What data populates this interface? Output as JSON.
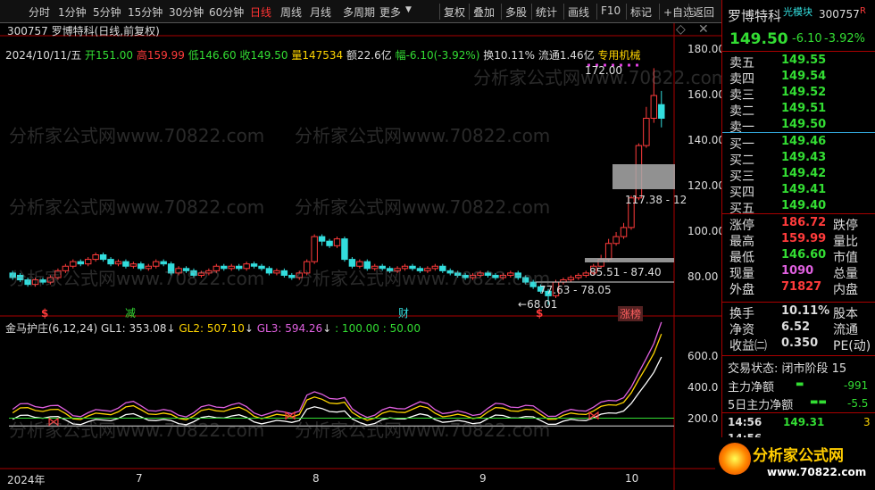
{
  "toolbar": {
    "left": [
      "分时",
      "1分钟",
      "5分钟",
      "15分钟",
      "30分钟",
      "60分钟",
      "日线",
      "周线",
      "月线",
      "多周期",
      "更多"
    ],
    "active": "日线",
    "right": [
      "复权",
      "叠加",
      "多股",
      "统计",
      "画线",
      "F10",
      "标记",
      "+自选",
      "返回"
    ]
  },
  "chart": {
    "title": "300757 罗博特科(日线,前复权)",
    "info_date": "2024/10/11/五",
    "info_open": "开151.00",
    "info_high": "高159.99",
    "info_low": "低146.60",
    "info_close": "收149.50",
    "info_vol": "量147534",
    "info_amount": "额22.6亿",
    "info_change": "幅-6.10(-3.92%)",
    "info_turn": "换10.11%",
    "info_float": "流通1.46亿",
    "info_sector": "专用机械",
    "y_ticks": [
      "180.00",
      "160.00",
      "140.00",
      "120.00",
      "100.00",
      "80.00"
    ],
    "labels": {
      "high": "172.00",
      "range1": "117.38 - 12",
      "range2": "85.51 - 87.40",
      "range3": "77.63 - 78.05",
      "low": "68.01"
    },
    "markers": {
      "m1": "$",
      "m2": "减",
      "m3": "财",
      "m4": "$",
      "m5": "涨榜"
    },
    "watermark": "分析家公式网www.70822.com"
  },
  "indicator": {
    "name": "金马护庄(6,12,24)",
    "gl1": "GL1: 353.08",
    "gl2": "GL2: 507.10",
    "gl3": "GL3: 594.26",
    "extra": ": 100.00 : 50.00",
    "y_ticks": [
      "600.0",
      "400.0",
      "200.0"
    ]
  },
  "xaxis": [
    "2024年",
    "7",
    "8",
    "9",
    "10"
  ],
  "quote": {
    "name": "罗博特科",
    "tag": "光模块",
    "code": "300757",
    "r": "R",
    "price": "149.50",
    "change": "-6.10",
    "pct": "-3.92%",
    "asks": [
      {
        "l": "卖五",
        "v": "149.55"
      },
      {
        "l": "卖四",
        "v": "149.54"
      },
      {
        "l": "卖三",
        "v": "149.52"
      },
      {
        "l": "卖二",
        "v": "149.51"
      },
      {
        "l": "卖一",
        "v": "149.50"
      }
    ],
    "bids": [
      {
        "l": "买一",
        "v": "149.46"
      },
      {
        "l": "买二",
        "v": "149.43"
      },
      {
        "l": "买三",
        "v": "149.42"
      },
      {
        "l": "买四",
        "v": "149.41"
      },
      {
        "l": "买五",
        "v": "149.40"
      }
    ],
    "stats": [
      {
        "l": "涨停",
        "v": "186.72",
        "c": "red",
        "l2": "跌停"
      },
      {
        "l": "最高",
        "v": "159.99",
        "c": "red",
        "l2": "量比"
      },
      {
        "l": "最低",
        "v": "146.60",
        "c": "green",
        "l2": "市值"
      },
      {
        "l": "现量",
        "v": "1090",
        "c": "magenta",
        "l2": "总量"
      },
      {
        "l": "外盘",
        "v": "71827",
        "c": "red",
        "l2": "内盘"
      }
    ],
    "stats2": [
      {
        "l": "换手",
        "v": "10.11%",
        "c": "white",
        "l2": "股本"
      },
      {
        "l": "净资",
        "v": "6.52",
        "c": "white",
        "l2": "流通"
      },
      {
        "l": "收益㈡",
        "v": "0.350",
        "c": "white",
        "l2": "PE(动)"
      }
    ],
    "trade_state": "交易状态: 闭市阶段 15",
    "main_net": "主力净额",
    "main_net_v": "-991",
    "main_net5": "5日主力净额",
    "main_net5_v": "-5.5",
    "ticks": [
      {
        "t": "14:56",
        "p": "149.31",
        "n": "3"
      },
      {
        "t": "14:56",
        "p": "",
        "n": ""
      }
    ],
    "logo": "分析家公式网",
    "logo_url": "www.70822.com"
  }
}
